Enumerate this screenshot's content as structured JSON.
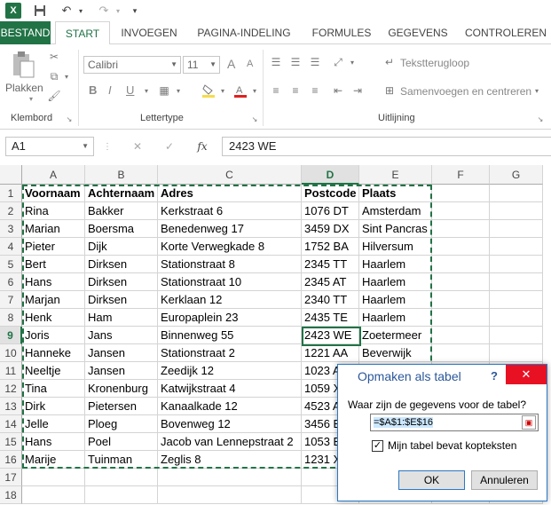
{
  "app": {
    "logo_text": "X",
    "undo_icon": "undo-icon",
    "redo_icon": "redo-icon"
  },
  "tabs": [
    {
      "label": "BESTAND",
      "state": "file"
    },
    {
      "label": "START",
      "state": "active"
    },
    {
      "label": "INVOEGEN",
      "state": ""
    },
    {
      "label": "PAGINA-INDELING",
      "state": ""
    },
    {
      "label": "FORMULES",
      "state": ""
    },
    {
      "label": "GEGEVENS",
      "state": ""
    },
    {
      "label": "CONTROLEREN",
      "state": ""
    }
  ],
  "ribbon": {
    "paste_label": "Plakken",
    "clipboard_label": "Klembord",
    "font_name": "Calibri",
    "font_size": "11",
    "grow_font": "A",
    "shrink_font": "A",
    "bold": "B",
    "italic": "I",
    "underline": "U",
    "font_group_label": "Lettertype",
    "wrap_text": "Tekstterugloop",
    "merge_center": "Samenvoegen en centreren",
    "alignment_label": "Uitlijning"
  },
  "formula_bar": {
    "name_box": "A1",
    "fx_label": "fx",
    "cancel_icon": "✕",
    "confirm_icon": "✓",
    "content": "2423 WE"
  },
  "sheet": {
    "columns": [
      "A",
      "B",
      "C",
      "D",
      "E",
      "F",
      "G"
    ],
    "selected_column": "D",
    "selected_row": 9,
    "row_numbers": [
      "1",
      "2",
      "3",
      "4",
      "5",
      "6",
      "7",
      "8",
      "9",
      "10",
      "11",
      "12",
      "13",
      "14",
      "15",
      "16",
      "17",
      "18"
    ],
    "rows": [
      [
        "Voornaam",
        "Achternaam",
        "Adres",
        "Postcode",
        "Plaats"
      ],
      [
        "Rina",
        "Bakker",
        "Kerkstraat 6",
        "1076 DT",
        "Amsterdam"
      ],
      [
        "Marian",
        "Boersma",
        "Benedenweg 17",
        "3459 DX",
        "Sint Pancras"
      ],
      [
        "Pieter",
        "Dijk",
        "Korte Verwegkade 8",
        "1752 BA",
        "Hilversum"
      ],
      [
        "Bert",
        "Dirksen",
        "Stationstraat 8",
        "2345 TT",
        "Haarlem"
      ],
      [
        "Hans",
        "Dirksen",
        "Stationstraat 10",
        "2345 AT",
        "Haarlem"
      ],
      [
        "Marjan",
        "Dirksen",
        "Kerklaan 12",
        "2340 TT",
        "Haarlem"
      ],
      [
        "Henk",
        "Ham",
        "Europaplein 23",
        "2435 TE",
        "Haarlem"
      ],
      [
        "Joris",
        "Jans",
        "Binnenweg 55",
        "2423 WE",
        "Zoetermeer"
      ],
      [
        "Hanneke",
        "Jansen",
        "Stationstraat 2",
        "1221 AA",
        "Beverwijk"
      ],
      [
        "Neeltje",
        "Jansen",
        "Zeedijk 12",
        "1023 A",
        ""
      ],
      [
        "Tina",
        "Kronenburg",
        "Katwijkstraat 4",
        "1059 X",
        ""
      ],
      [
        "Dirk",
        "Pietersen",
        "Kanaalkade 12",
        "4523 A",
        ""
      ],
      [
        "Jelle",
        "Ploeg",
        "Bovenweg 12",
        "3456 B",
        ""
      ],
      [
        "Hans",
        "Poel",
        "Jacob van Lennepstraat 2",
        "1053 B",
        ""
      ],
      [
        "Marije",
        "Tuinman",
        "Zeglis 8",
        "1231 X",
        ""
      ],
      [
        "",
        "",
        "",
        "",
        ""
      ],
      [
        "",
        "",
        "",
        "",
        ""
      ]
    ]
  },
  "dialog": {
    "title": "Opmaken als tabel",
    "help": "?",
    "close": "✕",
    "prompt": "Waar zijn de gegevens voor de tabel?",
    "range": "=$A$1:$E$16",
    "checkbox_checked": true,
    "checkbox_mark": "✓",
    "checkbox_label": "Mijn tabel bevat kopteksten",
    "ok": "OK",
    "cancel": "Annuleren"
  }
}
